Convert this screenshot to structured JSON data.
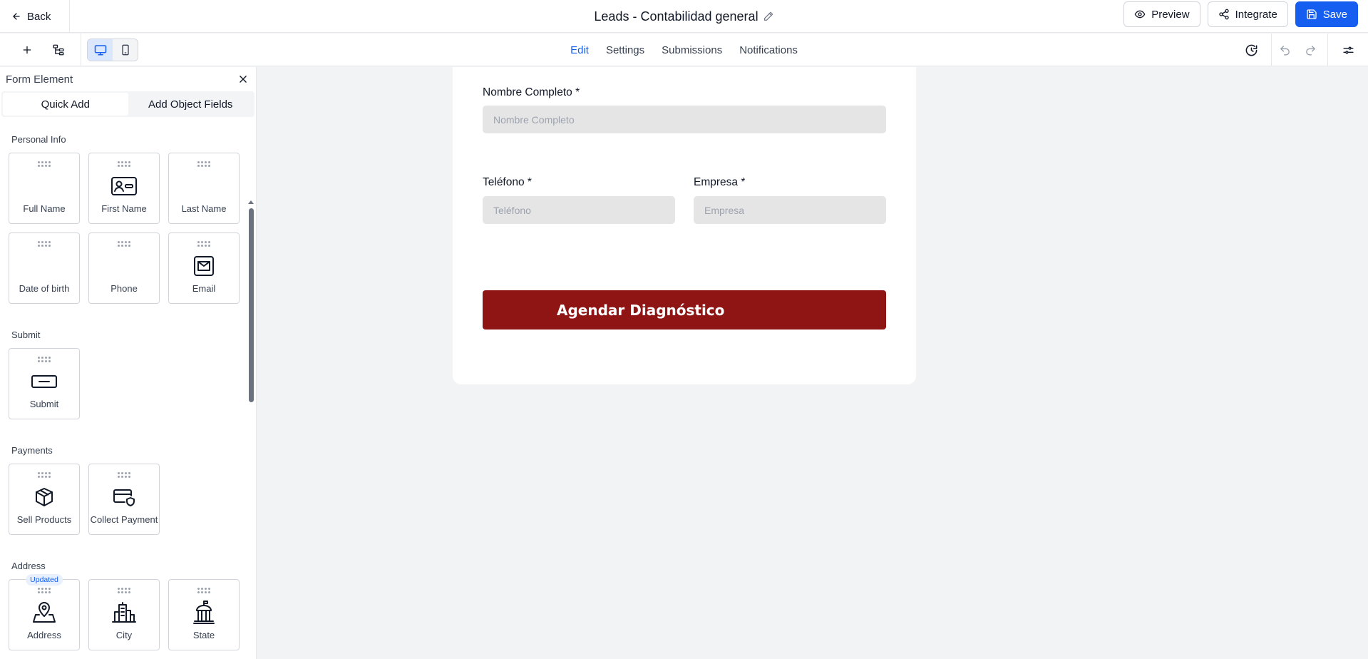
{
  "header": {
    "back_label": "Back",
    "title": "Leads - Contabilidad general",
    "preview_label": "Preview",
    "integrate_label": "Integrate",
    "save_label": "Save"
  },
  "nav": {
    "tabs": [
      {
        "label": "Edit",
        "active": true
      },
      {
        "label": "Settings",
        "active": false
      },
      {
        "label": "Submissions",
        "active": false
      },
      {
        "label": "Notifications",
        "active": false
      }
    ]
  },
  "sidebar": {
    "title": "Form Element",
    "tabs": [
      {
        "label": "Quick Add",
        "active": true
      },
      {
        "label": "Add Object Fields",
        "active": false
      }
    ],
    "sections": [
      {
        "label": "Personal Info",
        "items": [
          {
            "label": "Full Name",
            "icon": "none"
          },
          {
            "label": "First Name",
            "icon": "id-card-icon"
          },
          {
            "label": "Last Name",
            "icon": "none"
          },
          {
            "label": "Date of birth",
            "icon": "none"
          },
          {
            "label": "Phone",
            "icon": "none"
          },
          {
            "label": "Email",
            "icon": "envelope-icon"
          }
        ]
      },
      {
        "label": "Submit",
        "items": [
          {
            "label": "Submit",
            "icon": "submit-button-icon"
          }
        ]
      },
      {
        "label": "Payments",
        "items": [
          {
            "label": "Sell Products",
            "icon": "box-icon"
          },
          {
            "label": "Collect Payment",
            "icon": "card-shield-icon"
          }
        ]
      },
      {
        "label": "Address",
        "items": [
          {
            "label": "Address",
            "icon": "map-pin-icon",
            "badge": "Updated"
          },
          {
            "label": "City",
            "icon": "city-icon"
          },
          {
            "label": "State",
            "icon": "capitol-icon"
          }
        ]
      }
    ]
  },
  "form": {
    "full_name_label": "Nombre Completo *",
    "full_name_placeholder": "Nombre Completo",
    "phone_label": "Teléfono *",
    "phone_placeholder": "Teléfono",
    "company_label": "Empresa *",
    "company_placeholder": "Empresa",
    "submit_label": "Agendar Diagnóstico",
    "submit_color": "#8f1515"
  },
  "colors": {
    "accent": "#155eef",
    "canvas_bg": "#f2f3f5",
    "input_bg": "#e5e5e5"
  }
}
